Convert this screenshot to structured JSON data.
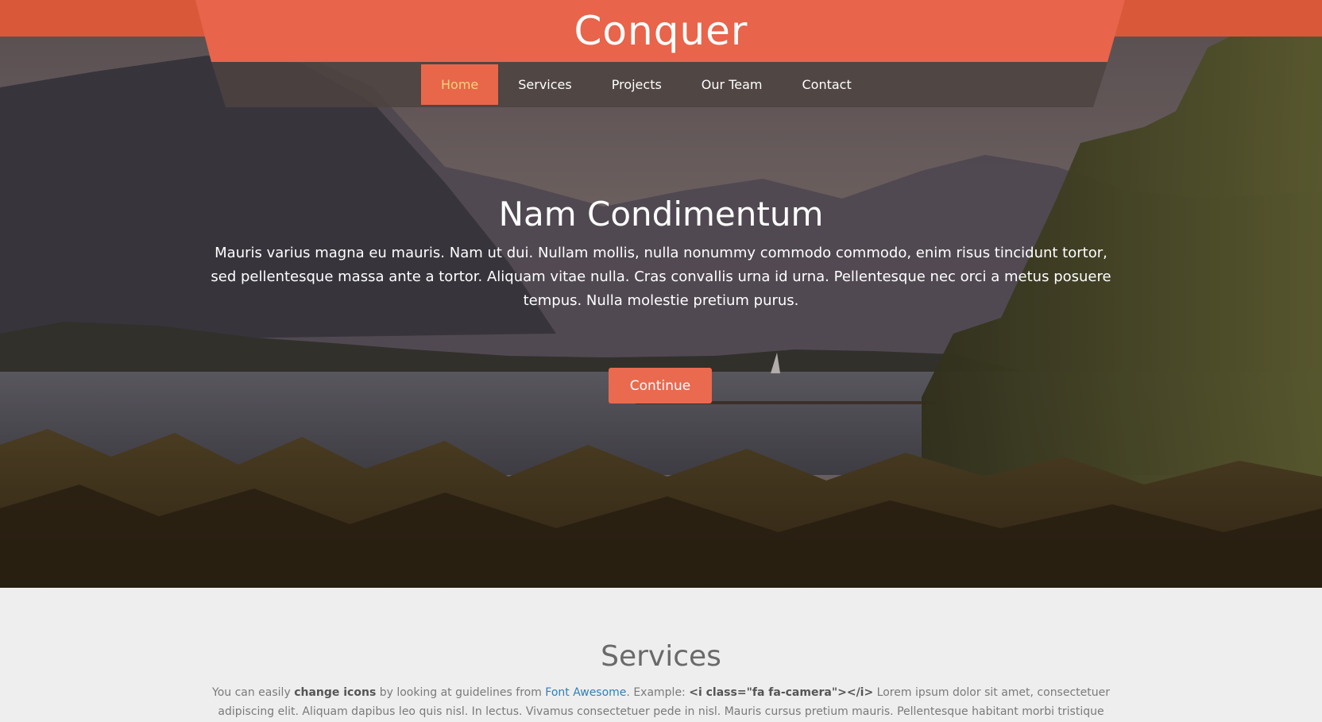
{
  "brand": {
    "name": "Conquer"
  },
  "nav": {
    "items": [
      {
        "label": "Home",
        "active": true
      },
      {
        "label": "Services",
        "active": false
      },
      {
        "label": "Projects",
        "active": false
      },
      {
        "label": "Our Team",
        "active": false
      },
      {
        "label": "Contact",
        "active": false
      }
    ]
  },
  "hero": {
    "title": "Nam Condimentum",
    "text": "Mauris varius magna eu mauris. Nam ut dui. Nullam mollis, nulla nonummy commodo commodo, enim risus tincidunt tortor, sed pellentesque massa ante a tortor. Aliquam vitae nulla. Cras convallis urna id urna. Pellentesque nec orci a metus posuere tempus. Nulla molestie pretium purus.",
    "button_label": "Continue"
  },
  "services": {
    "title": "Services",
    "intro_1": "You can easily ",
    "intro_bold_1": "change icons",
    "intro_2": " by looking at guidelines from ",
    "intro_link": "Font Awesome",
    "intro_3": ". Example: ",
    "intro_bold_2": "<i class=\"fa fa-camera\"></i>",
    "intro_4": " Lorem ipsum dolor sit amet, consectetuer adipiscing elit. Aliquam dapibus leo quis nisl. In lectus. Vivamus consectetuer pede in nisl. Mauris cursus pretium mauris. Pellentesque habitant morbi tristique senectus et netus et"
  },
  "colors": {
    "brand_orange": "#d9583a",
    "banner_orange": "#e8644a",
    "active_nav_text": "#f6d37a",
    "button": "#ea6a50",
    "link": "#2f80b8",
    "services_bg": "#efeeee"
  }
}
